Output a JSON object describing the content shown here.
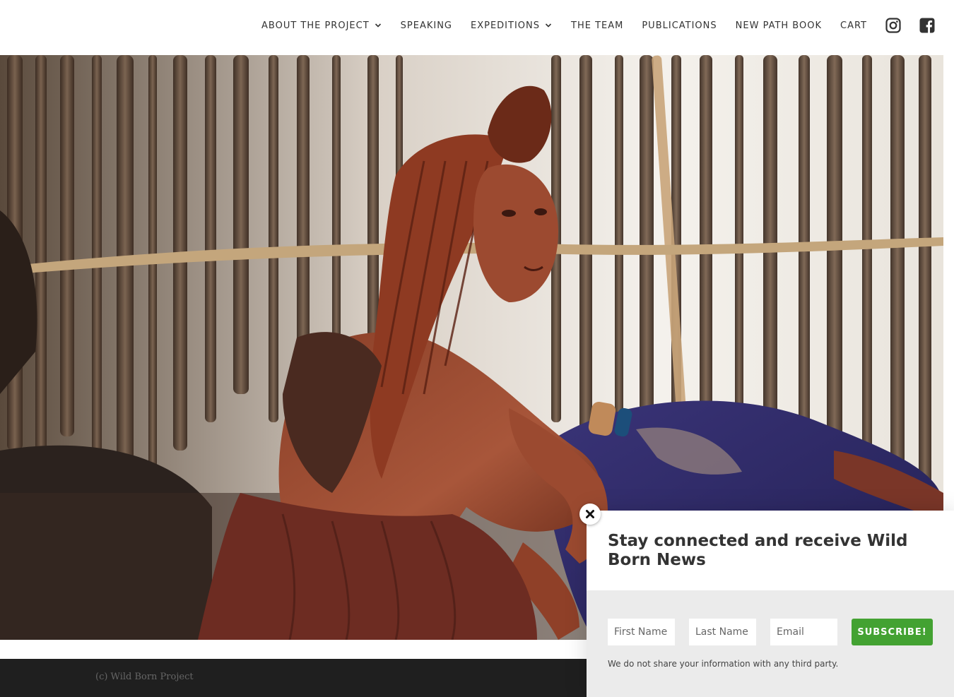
{
  "nav": {
    "items": [
      {
        "label": "ABOUT THE PROJECT",
        "has_dropdown": true
      },
      {
        "label": "SPEAKING",
        "has_dropdown": false
      },
      {
        "label": "EXPEDITIONS",
        "has_dropdown": true
      },
      {
        "label": "THE TEAM",
        "has_dropdown": false
      },
      {
        "label": "PUBLICATIONS",
        "has_dropdown": false
      },
      {
        "label": "NEW PATH BOOK",
        "has_dropdown": false
      },
      {
        "label": "CART",
        "has_dropdown": false
      }
    ],
    "social_icons": [
      "instagram-icon",
      "facebook-icon"
    ]
  },
  "hero": {
    "image": "photo-woman-in-wooden-hut"
  },
  "footer": {
    "copyright": "(c) Wild Born Project"
  },
  "popup": {
    "title": "Stay connected and receive Wild Born News",
    "first_name_placeholder": "First Name",
    "last_name_placeholder": "Last Name",
    "email_placeholder": "Email",
    "subscribe_label": "SUBSCRIBE!",
    "disclaimer": "We do not share your information with any third party.",
    "close_icon": "close-icon"
  },
  "colors": {
    "accent_green": "#43a232",
    "nav_text": "#333333",
    "footer_bg": "#1f1f1f",
    "form_bg": "#ebebeb"
  }
}
